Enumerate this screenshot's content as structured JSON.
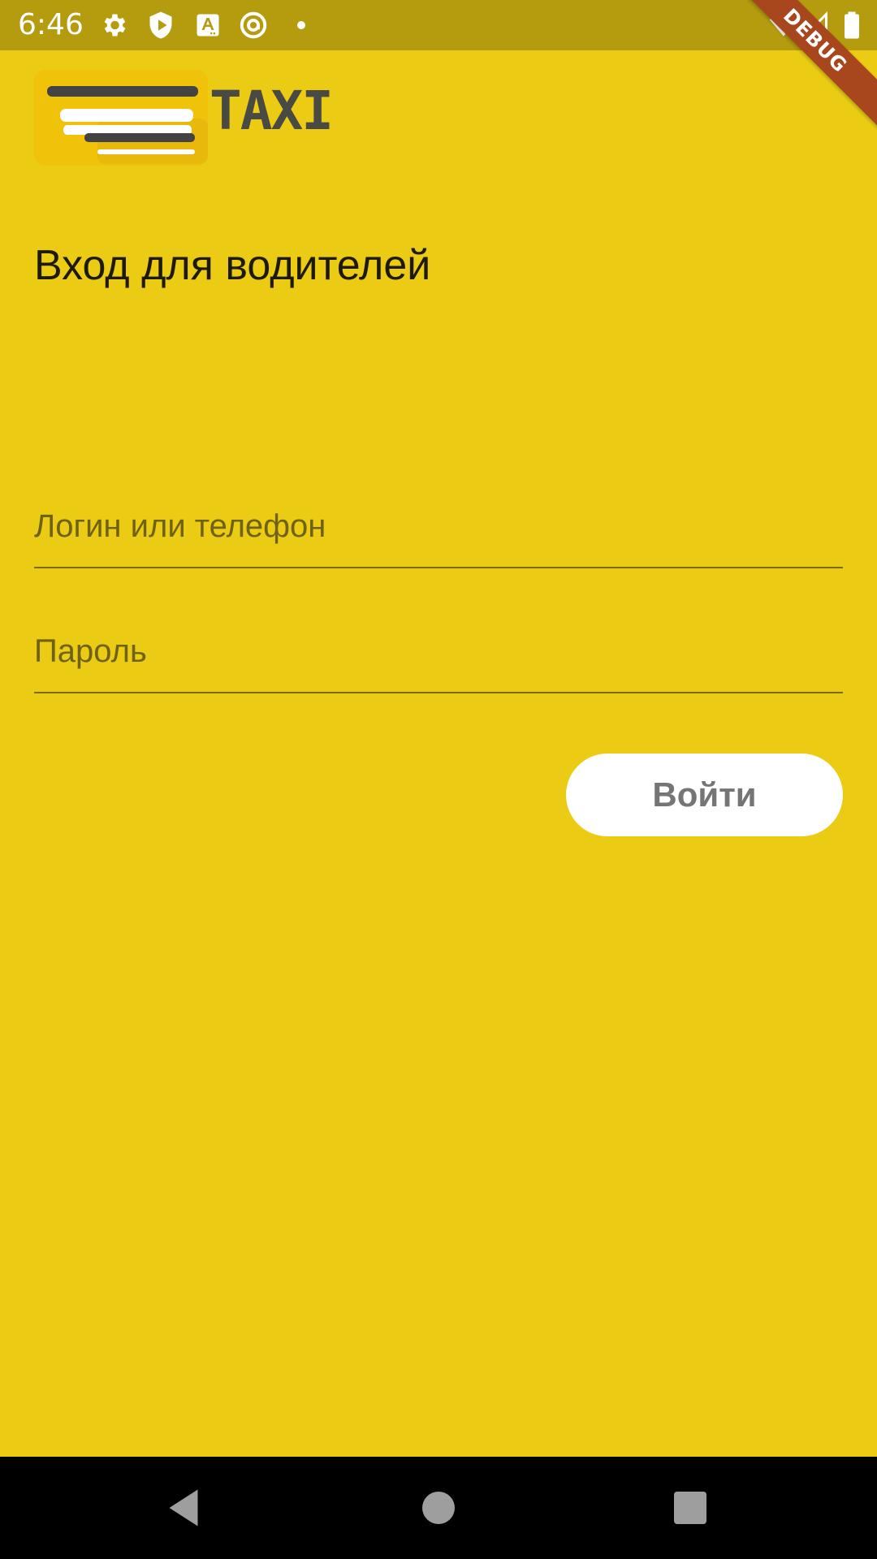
{
  "status_bar": {
    "time": "6:46",
    "icons": [
      "gear-icon",
      "shield-play-icon",
      "text-a-icon",
      "at-circle-icon",
      "notification-dot",
      "wifi-icon",
      "signal-icon",
      "battery-icon"
    ]
  },
  "debug_banner": {
    "label": "DEBUG"
  },
  "logo": {
    "text": "TAXI"
  },
  "login": {
    "title": "Вход для водителей",
    "login_placeholder": "Логин или телефон",
    "password_placeholder": "Пароль",
    "submit_label": "Войти"
  },
  "nav_bar": {
    "icons": [
      "back-icon",
      "home-icon",
      "recents-icon"
    ]
  },
  "colors": {
    "background": "#EBCB13",
    "status_bar": "#B59B0E",
    "debug_ribbon": "#A8471E",
    "button": "#FFFFFF",
    "nav_bar": "#000000"
  }
}
